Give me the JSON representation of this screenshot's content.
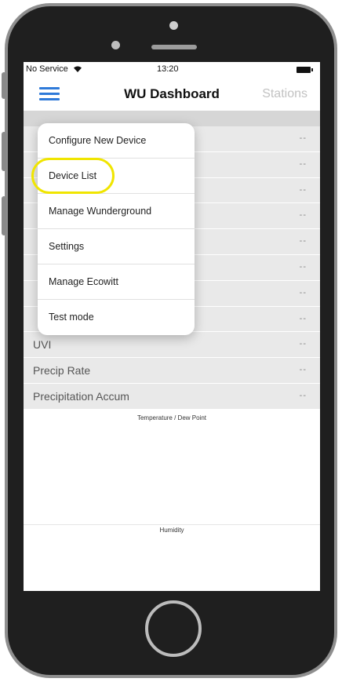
{
  "status_bar": {
    "carrier": "No Service",
    "time": "13:20"
  },
  "nav": {
    "title": "WU Dashboard",
    "right_label": "Stations",
    "menu_icon": "hamburger-menu-icon"
  },
  "list": {
    "rows": [
      {
        "label": "",
        "value": "--"
      },
      {
        "label": "",
        "value": "--"
      },
      {
        "label": "",
        "value": "--"
      },
      {
        "label": "",
        "value": "--"
      },
      {
        "label": "",
        "value": "--"
      },
      {
        "label": "",
        "value": "--"
      },
      {
        "label": "",
        "value": "--"
      },
      {
        "label": "",
        "value": "--"
      },
      {
        "label": "UVI",
        "value": "--"
      },
      {
        "label": "Precip Rate",
        "value": "--"
      },
      {
        "label": "Precipitation Accum",
        "value": "--"
      }
    ]
  },
  "charts": {
    "temperature_title": "Temperature / Dew Point",
    "humidity_title": "Humidity"
  },
  "menu": {
    "items": [
      {
        "label": "Configure New Device"
      },
      {
        "label": "Device List"
      },
      {
        "label": "Manage Wunderground"
      },
      {
        "label": "Settings"
      },
      {
        "label": "Manage Ecowitt"
      },
      {
        "label": "Test mode"
      }
    ]
  },
  "colors": {
    "accent": "#2f7ad9",
    "highlight": "#f0e500"
  }
}
